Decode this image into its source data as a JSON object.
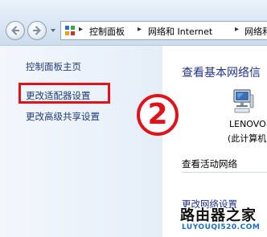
{
  "address_bar": {
    "crumbs": [
      "控制面板",
      "网络和 Internet",
      "网络和"
    ]
  },
  "left_pane": {
    "home_link": "控制面板主页",
    "adapter_link": "更改适配器设置",
    "sharing_link": "更改高级共享设置"
  },
  "annotation": {
    "step": "2",
    "highlight_color": "#e0121a"
  },
  "main": {
    "title": "查看基本网络信",
    "computer_name": "LENOVO-",
    "computer_sub": "(此计算机",
    "active_networks": "查看活动网络",
    "change_settings": "更改网络设置"
  },
  "watermark": {
    "name": "路由器之家",
    "url": "LUYOUQI520.COM"
  }
}
